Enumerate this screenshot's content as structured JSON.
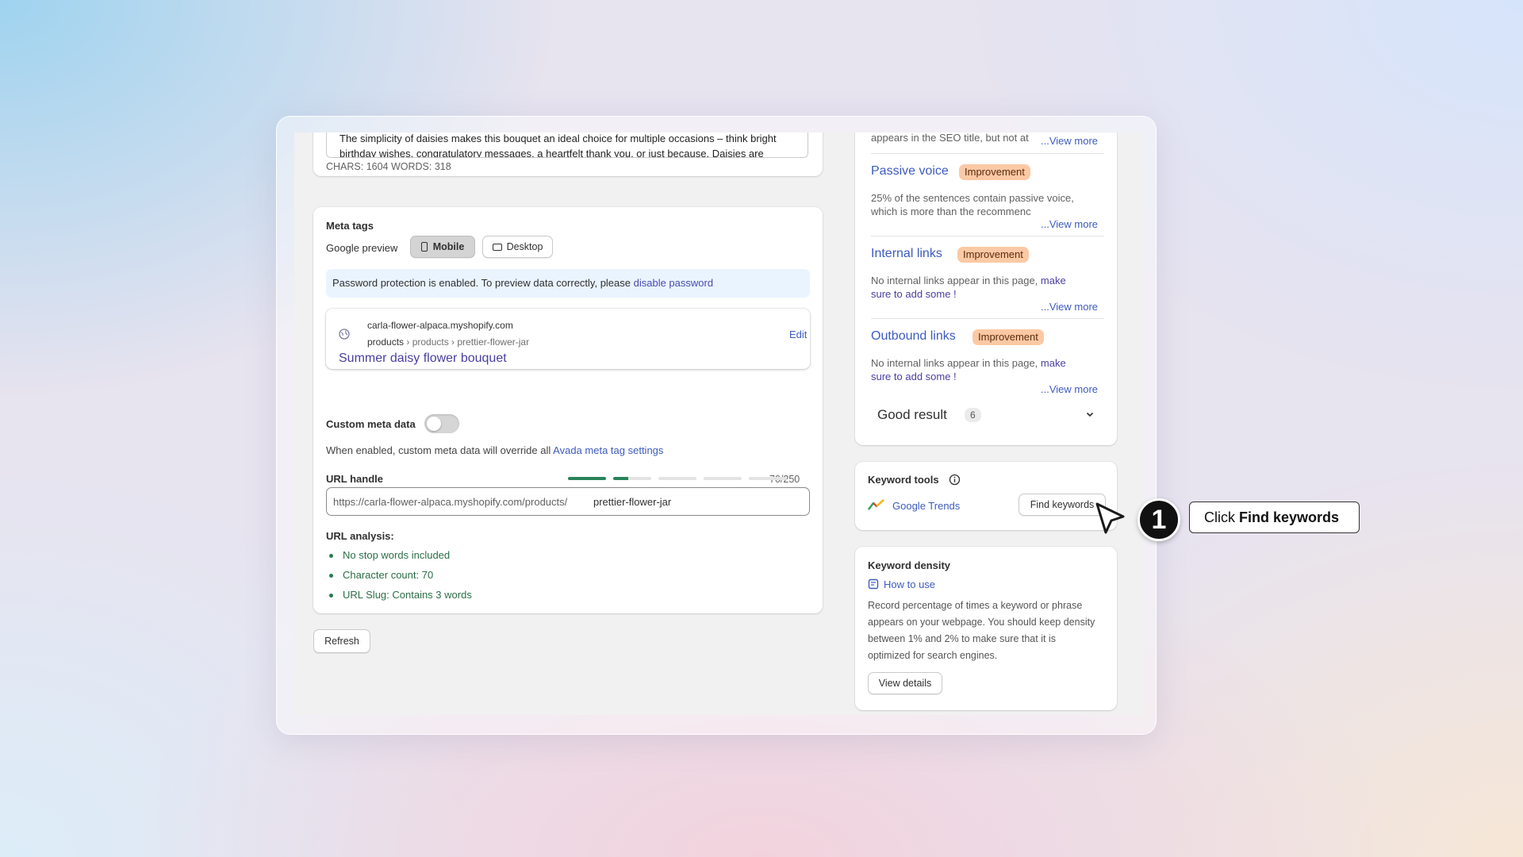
{
  "description_card": {
    "text_line1": "The simplicity of daisies makes this bouquet an ideal choice for multiple occasions – think bright",
    "text_line2": "birthday wishes, congratulatory messages, a heartfelt thank you, or just because. Daisies are",
    "counts": "CHARS: 1604 WORDS: 318"
  },
  "meta_tags": {
    "title": "Meta tags",
    "google_preview_label": "Google preview",
    "mobile_label": "Mobile",
    "desktop_label": "Desktop",
    "password_notice": "Password protection is enabled. To preview data correctly, please",
    "password_link": "disable password",
    "preview": {
      "domain": "carla-flower-alpaca.myshopify.com",
      "breadcrumb_root": "products",
      "breadcrumb_rest": " › products › prettier-flower-jar",
      "title": "Summer daisy flower bouquet",
      "edit_label": "Edit"
    },
    "custom_meta_label": "Custom meta data",
    "custom_meta_enabled": false,
    "custom_meta_note": "When enabled, custom meta data will override all",
    "custom_meta_link": "Avada meta tag settings",
    "url_handle_label": "URL handle",
    "url_handle_count": "70/250",
    "url_prefix": "https://carla-flower-alpaca.myshopify.com/products/",
    "url_handle_value": "prettier-flower-jar",
    "url_analysis_label": "URL analysis:",
    "url_analysis_items": [
      "No stop words included",
      "Character count: 70",
      "URL Slug: Contains 3 words"
    ]
  },
  "refresh_label": "Refresh",
  "seo_checks": {
    "top_text": "appears in the SEO title, but not at",
    "view_more": "...View more",
    "items": [
      {
        "title": "Passive voice",
        "badge": "Improvement",
        "line1": "25% of the sentences contain passive voice,",
        "line2": "which is more than the recommenc"
      },
      {
        "title": "Internal links",
        "badge": "Improvement",
        "line1": "No internal links appear in this page,",
        "link1": "make",
        "link2": "sure to add some !"
      },
      {
        "title": "Outbound links",
        "badge": "Improvement",
        "line1": "No internal links appear in this page,",
        "link1": "make",
        "link2": "sure to add some !"
      }
    ],
    "good_result_label": "Good result",
    "good_result_count": "6"
  },
  "keyword_tools": {
    "title": "Keyword tools",
    "google_trends": "Google Trends",
    "find_keywords": "Find keywords"
  },
  "keyword_density": {
    "title": "Keyword density",
    "how_to_use": "How to use",
    "desc_lines": [
      "Record percentage of times a keyword or phrase",
      "appears on your webpage. You should keep density",
      "between 1% and 2% to make sure that it is",
      "optimized for search engines."
    ],
    "view_details": "View details"
  },
  "tutorial": {
    "step_number": "1",
    "callout_prefix": "Click ",
    "callout_bold": "Find keywords"
  }
}
